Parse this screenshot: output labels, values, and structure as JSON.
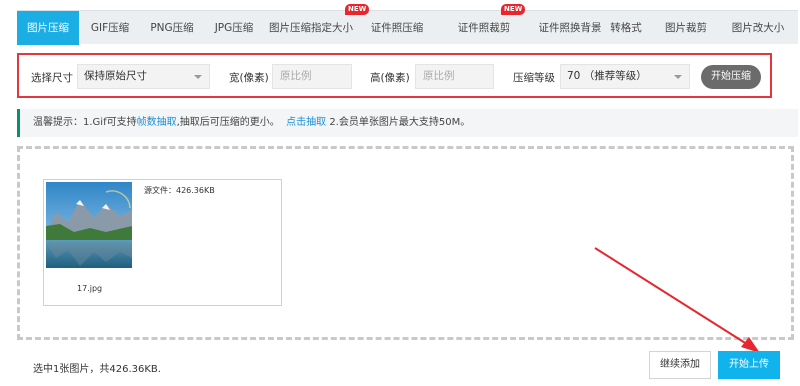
{
  "tabs": [
    {
      "label": "图片压缩",
      "active": true
    },
    {
      "label": "GIF压缩",
      "active": false
    },
    {
      "label": "PNG压缩",
      "active": false
    },
    {
      "label": "JPG压缩",
      "active": false
    },
    {
      "label": "图片压缩指定大小",
      "active": false,
      "badge": "NEW"
    },
    {
      "label": "证件照压缩",
      "active": false
    },
    {
      "label": "证件照裁剪",
      "active": false,
      "badge": "NEW"
    },
    {
      "label": "证件照换背景",
      "active": false
    },
    {
      "label": "转格式",
      "active": false
    },
    {
      "label": "图片裁剪",
      "active": false
    },
    {
      "label": "图片改大小",
      "active": false
    }
  ],
  "settings": {
    "size_label": "选择尺寸",
    "size_value": "保持原始尺寸",
    "width_label": "宽(像素)",
    "width_placeholder": "原比例",
    "height_label": "高(像素)",
    "height_placeholder": "原比例",
    "level_label": "压缩等级",
    "level_value": "70 （推荐等级）",
    "start_compress": "开始压缩"
  },
  "tip": {
    "prefix": "温馨提示：1.Gif可支持",
    "link1": "帧数抽取",
    "middle": ",抽取后可压缩的更小。",
    "link2": "点击抽取",
    "suffix": " 2.会员单张图片最大支持50M。"
  },
  "file": {
    "source_info": "源文件：426.36KB",
    "name": "17.jpg"
  },
  "footer": {
    "status": "选中1张图片，共426.36KB.",
    "continue_add": "继续添加",
    "start_upload": "开始上传"
  },
  "colors": {
    "accent": "#1aaee5",
    "highlight_border": "#e2383d",
    "arrow": "#e8262d",
    "tip_border": "#0a8f72"
  }
}
